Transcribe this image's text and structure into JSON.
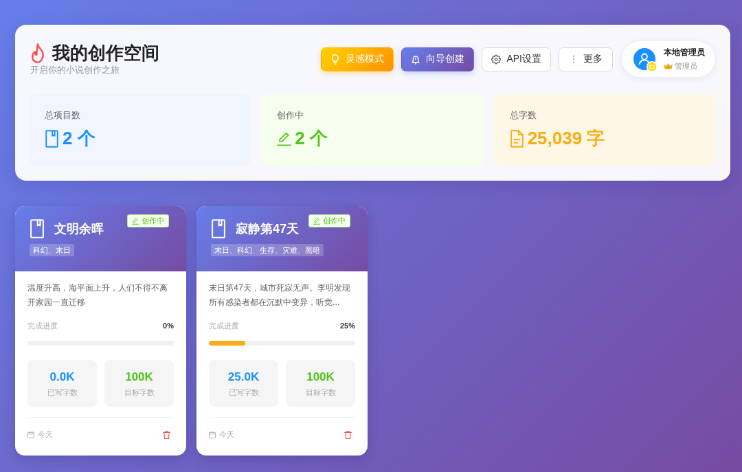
{
  "header": {
    "title": "我的创作空间",
    "subtitle": "开启你的小说创作之旅",
    "actions": [
      {
        "label": "灵感模式",
        "kind": "inspiration"
      },
      {
        "label": "向导创建",
        "kind": "wizard"
      },
      {
        "label": "API设置",
        "kind": "settings"
      },
      {
        "label": "更多",
        "kind": "more"
      }
    ],
    "user": {
      "name": "本地管理员",
      "role": "管理员"
    }
  },
  "stats": [
    {
      "label": "总项目数",
      "value": "2 个",
      "kind": "projects"
    },
    {
      "label": "创作中",
      "value": "2 个",
      "kind": "writing"
    },
    {
      "label": "总字数",
      "value": "25,039 字",
      "kind": "words"
    }
  ],
  "projects": [
    {
      "title": "文明余晖",
      "status": "创作中",
      "tags": "科幻、末日",
      "description": "温度升高，海平面上升，人们不得不离开家园一直迁移",
      "progress_label": "完成进度",
      "progress": "0%",
      "level": 0,
      "written": "0.0K",
      "written_label": "已写字数",
      "target": "100K",
      "target_label": "目标字数",
      "date": "今天"
    },
    {
      "title": "寂静第47天",
      "status": "创作中",
      "tags": "末日、科幻、生存、灾难、黑暗",
      "description": "末日第47天，城市死寂无声。李明发现所有感染者都在沉默中变异，听觉...",
      "progress_label": "完成进度",
      "progress": "25%",
      "level": 0.25,
      "written": "25.0K",
      "written_label": "已写字数",
      "target": "100K",
      "target_label": "目标字数",
      "date": "今天"
    }
  ]
}
